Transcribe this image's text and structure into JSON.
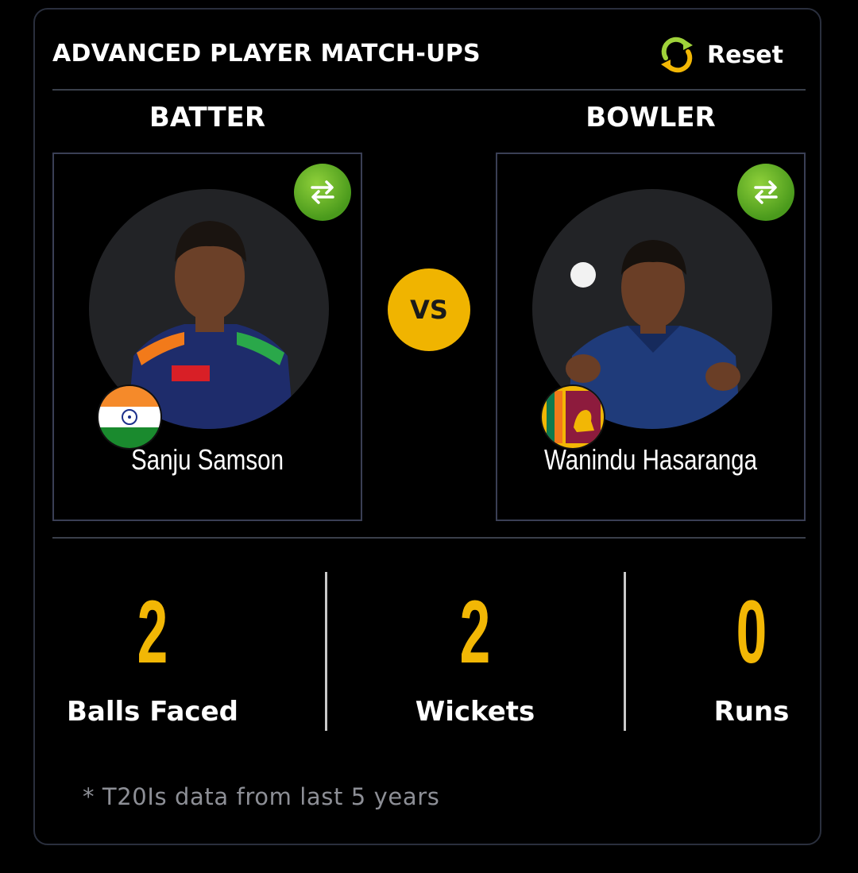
{
  "header": {
    "title": "ADVANCED PLAYER MATCH-UPS",
    "reset_label": "Reset"
  },
  "batter": {
    "heading": "BATTER",
    "name": "Sanju Samson",
    "flag_icon": "india-flag-icon"
  },
  "bowler": {
    "heading": "BOWLER",
    "name": "Wanindu Hasaranga",
    "flag_icon": "sri-lanka-flag-icon"
  },
  "vs_label": "VS",
  "stats": [
    {
      "value": "2",
      "label": "Balls Faced"
    },
    {
      "value": "2",
      "label": "Wickets"
    },
    {
      "value": "0",
      "label": "Runs"
    }
  ],
  "footnote": "* T20Is data from last 5 years",
  "colors": {
    "accent": "#f2b705",
    "swap_green": "#5aa823",
    "border": "#3a3f55"
  }
}
